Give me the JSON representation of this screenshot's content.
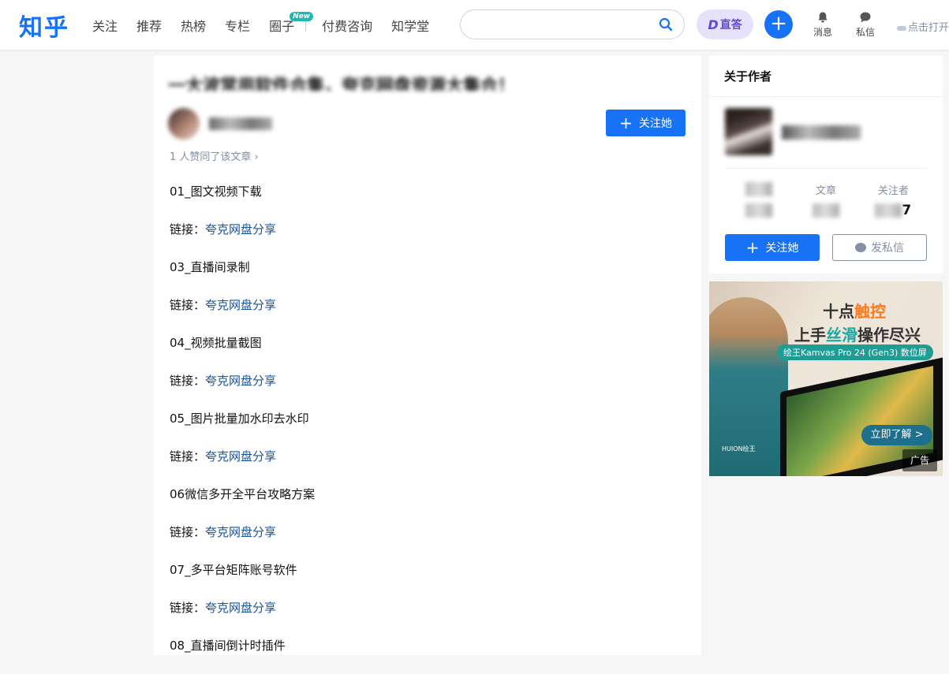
{
  "header": {
    "logo": "知乎",
    "nav": [
      {
        "label": "关注"
      },
      {
        "label": "推荐"
      },
      {
        "label": "热榜"
      },
      {
        "label": "专栏"
      },
      {
        "label": "圈子",
        "badge": "New"
      },
      {
        "label": "付费咨询"
      },
      {
        "label": "知学堂"
      }
    ],
    "search": {
      "placeholder": "",
      "value": ""
    },
    "zhida_label": "直答",
    "plus_label": "+",
    "messages_label": "消息",
    "dm_label": "私信",
    "open_app_label": "点击打开"
  },
  "article": {
    "title": "一大波常用软件合集，夸克网盘资源大集合！",
    "author_name": "",
    "follow_label": "关注她",
    "likes_text": "1 人赞同了该文章 ›",
    "items": [
      {
        "title": "01_图文视频下载",
        "link_prefix": "链接：",
        "link_text": "夸克网盘分享"
      },
      {
        "title": "03_直播间录制",
        "link_prefix": "链接：",
        "link_text": "夸克网盘分享"
      },
      {
        "title": "04_视频批量截图",
        "link_prefix": "链接：",
        "link_text": "夸克网盘分享"
      },
      {
        "title": "05_图片批量加水印去水印",
        "link_prefix": "链接：",
        "link_text": "夸克网盘分享"
      },
      {
        "title": "06微信多开全平台攻略方案",
        "link_prefix": "链接：",
        "link_text": "夸克网盘分享"
      },
      {
        "title": "07_多平台矩阵账号软件",
        "link_prefix": "链接：",
        "link_text": "夸克网盘分享"
      },
      {
        "title": "08_直播间倒计时插件"
      }
    ]
  },
  "sidebar": {
    "about_title": "关于作者",
    "stats": [
      {
        "label": "",
        "value": ""
      },
      {
        "label": "文章",
        "value": ""
      },
      {
        "label": "关注者",
        "value": "7"
      }
    ],
    "follow_label": "关注她",
    "message_label": "发私信"
  },
  "ad": {
    "line1_a": "十点",
    "line1_b": "触控",
    "line2_a": "上手",
    "line2_b": "丝滑",
    "line2_c": "操作尽兴",
    "pill": "绘王Kamvas Pro 24 (Gen3) 数位屏",
    "cta": "立即了解 >",
    "brand": "HUION绘王",
    "tag": "广告"
  }
}
